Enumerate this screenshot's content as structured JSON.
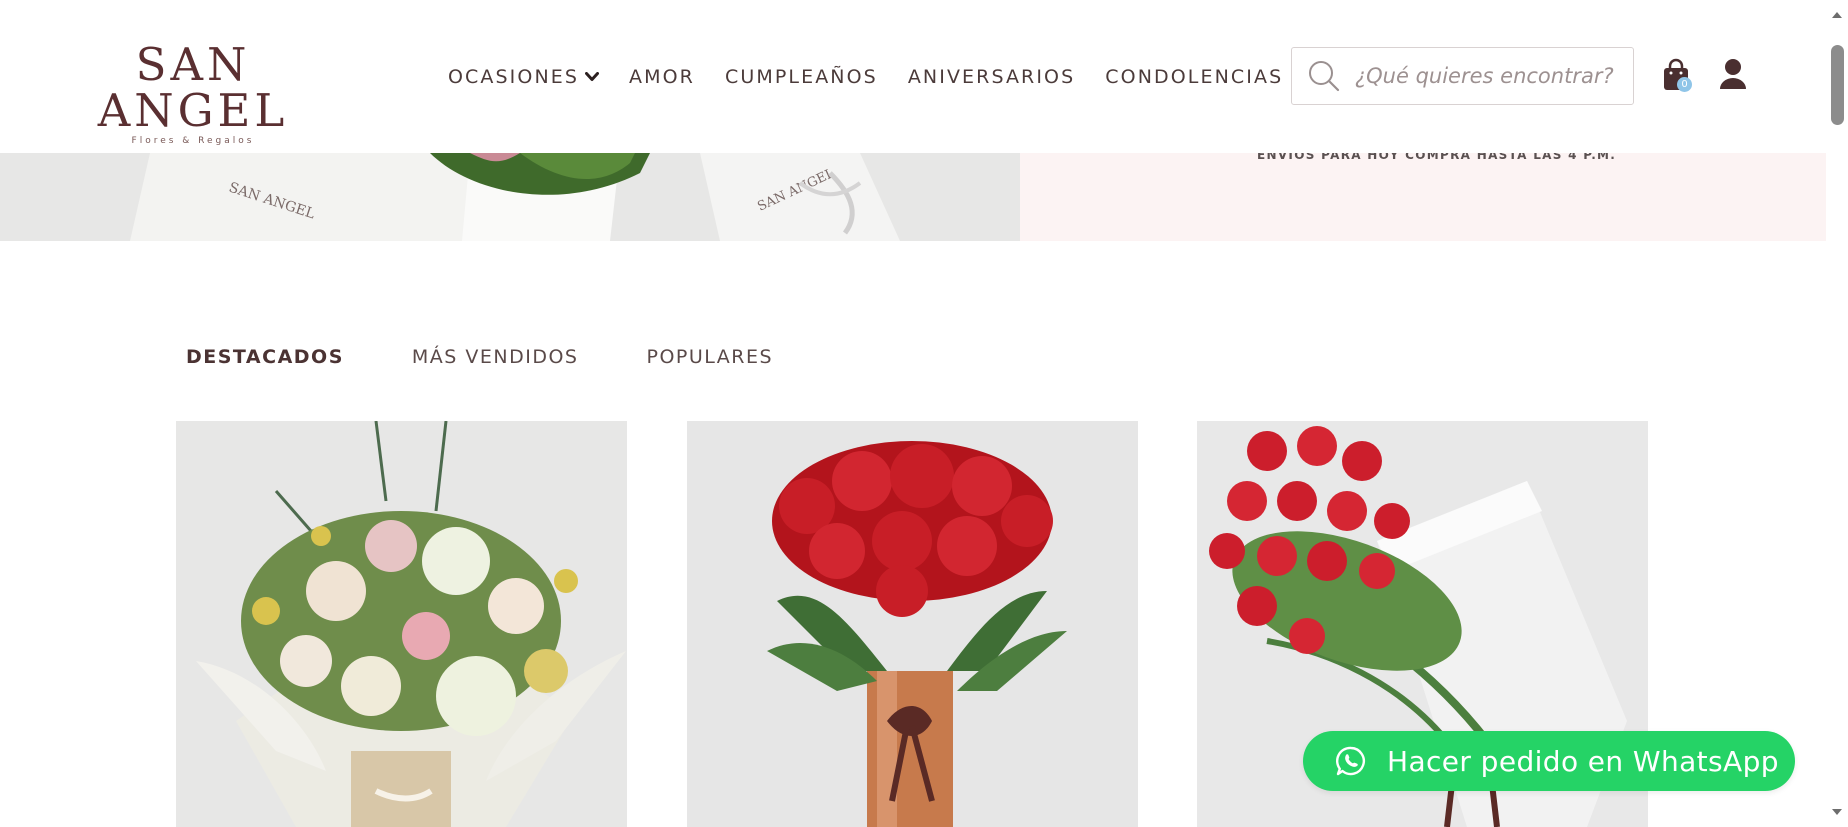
{
  "header": {
    "logo_main": "SAN ANGEL",
    "logo_sub": "Flores & Regalos",
    "nav": [
      {
        "label": "OCASIONES",
        "has_dropdown": true
      },
      {
        "label": "AMOR"
      },
      {
        "label": "CUMPLEAÑOS"
      },
      {
        "label": "ANIVERSARIOS"
      },
      {
        "label": "CONDOLENCIAS"
      }
    ],
    "search": {
      "placeholder": "¿Qué quieres encontrar?",
      "value": ""
    },
    "cart_count": "0",
    "icons": {
      "search": "search-icon",
      "cart": "shopping-bag-icon",
      "user": "user-icon",
      "dropdown": "chevron-down-icon"
    }
  },
  "hero": {
    "banner_text": "ENVIOS PARA HOY COMPRA HASTA LAS 4 P.M."
  },
  "tabs": [
    {
      "label": "DESTACADOS",
      "active": true
    },
    {
      "label": "MÁS VENDIDOS",
      "active": false
    },
    {
      "label": "POPULARES",
      "active": false
    }
  ],
  "products": [
    {
      "image": "mixed-flower-bouquet-image"
    },
    {
      "image": "red-roses-copper-vase-image"
    },
    {
      "image": "red-roses-white-box-image"
    }
  ],
  "whatsapp": {
    "label": "Hacer pedido en WhatsApp",
    "icon": "whatsapp-icon"
  },
  "colors": {
    "brand": "#5a2f31",
    "whatsapp": "#25d366",
    "banner": "#fcf3f3",
    "cart_badge": "#8fc5e8"
  }
}
